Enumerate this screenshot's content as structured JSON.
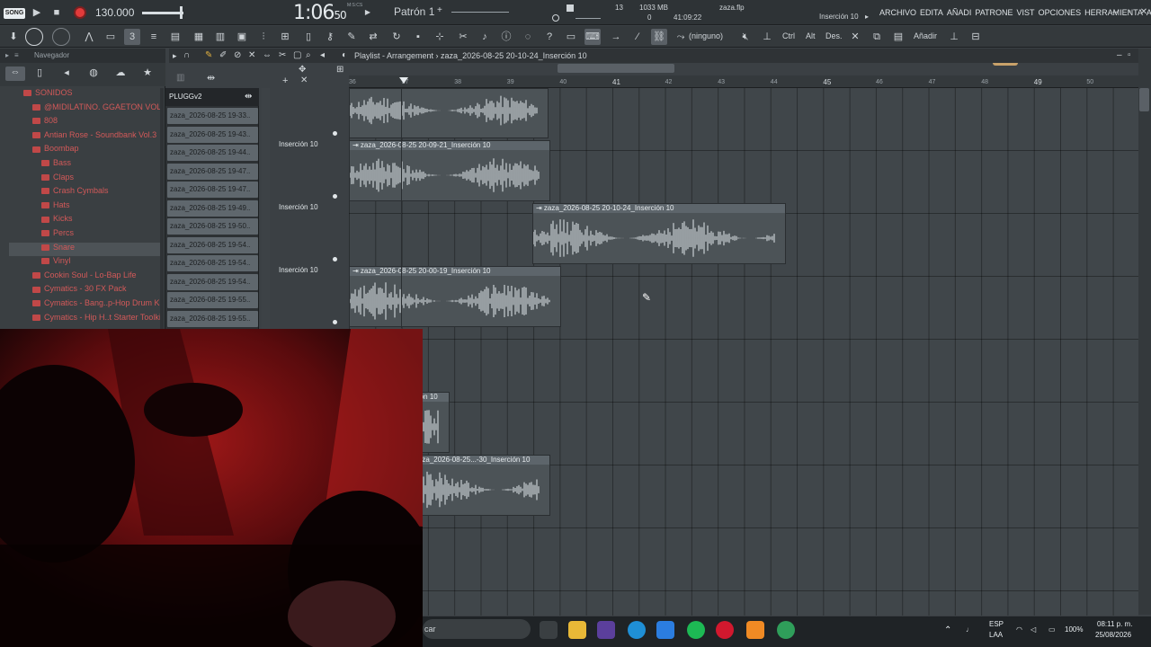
{
  "transport": {
    "mode_badge": "SONG",
    "play": "▶",
    "stop": "■",
    "tempo": "130.000",
    "time_main": "1:06",
    "time_small": "50",
    "time_label": "M:S:CS",
    "pattern": "Patrón 1",
    "cpu": "13",
    "mem": "1033 MB",
    "mem_sub": "0",
    "elapsed": "41:09:22",
    "file": "zaza.flp",
    "insert": "Inserción 10"
  },
  "menu": [
    "ARCHIVO",
    "EDITA",
    "AÑADI",
    "PATRONE",
    "VIST",
    "OPCIONES",
    "HERRAMIENTA",
    "AY"
  ],
  "toolbar": {
    "none_label": "(ninguno)",
    "ctrl": "Ctrl",
    "alt": "Alt",
    "des": "Des.",
    "add": "Añadir"
  },
  "browser": {
    "title": "Navegador",
    "items": [
      {
        "label": "SONIDOS",
        "level": 0,
        "selected": false
      },
      {
        "label": "@MIDILATINO. GGAETON VOL. 1",
        "level": 1,
        "selected": false
      },
      {
        "label": "808",
        "level": 1,
        "selected": false
      },
      {
        "label": "Antian Rose - Soundbank Vol.3",
        "level": 1,
        "selected": false
      },
      {
        "label": "Boombap",
        "level": 1,
        "selected": false
      },
      {
        "label": "Bass",
        "level": 2,
        "selected": false
      },
      {
        "label": "Claps",
        "level": 2,
        "selected": false
      },
      {
        "label": "Crash Cymbals",
        "level": 2,
        "selected": false
      },
      {
        "label": "Hats",
        "level": 2,
        "selected": false
      },
      {
        "label": "Kicks",
        "level": 2,
        "selected": false
      },
      {
        "label": "Percs",
        "level": 2,
        "selected": false
      },
      {
        "label": "Snare",
        "level": 2,
        "selected": true
      },
      {
        "label": "Vinyl",
        "level": 2,
        "selected": false
      },
      {
        "label": "Cookin Soul - Lo-Bap Life",
        "level": 1,
        "selected": false
      },
      {
        "label": "Cymatics - 30 FX Pack",
        "level": 1,
        "selected": false
      },
      {
        "label": "Cymatics - Bang..p-Hop Drum Kit",
        "level": 1,
        "selected": false
      },
      {
        "label": "Cymatics - Hip H..t Starter Toolkit",
        "level": 1,
        "selected": false
      }
    ]
  },
  "picker": {
    "header": "PLUGGv2",
    "items": [
      "zaza_2026-08-25 19-33..",
      "zaza_2026-08-25 19-43..",
      "zaza_2026-08-25 19-44..",
      "zaza_2026-08-25 19-47..",
      "zaza_2026-08-25 19-47..",
      "zaza_2026-08-25 19-49..",
      "zaza_2026-08-25 19-50..",
      "zaza_2026-08-25 19-54..",
      "zaza_2026-08-25 19-54..",
      "zaza_2026-08-25 19-54..",
      "zaza_2026-08-25 19-55..",
      "zaza_2026-08-25 19-55.."
    ]
  },
  "playlist": {
    "title": "Playlist - Arrangement",
    "breadcrumb": "zaza_2026-08-25 20-10-24_Inserción 10"
  },
  "ruler": [
    {
      "label": "36",
      "bar": false
    },
    {
      "label": "37",
      "bar": false
    },
    {
      "label": "38",
      "bar": false
    },
    {
      "label": "39",
      "bar": false
    },
    {
      "label": "40",
      "bar": false
    },
    {
      "label": "41",
      "bar": true
    },
    {
      "label": "42",
      "bar": false
    },
    {
      "label": "43",
      "bar": false
    },
    {
      "label": "44",
      "bar": false
    },
    {
      "label": "45",
      "bar": true
    },
    {
      "label": "46",
      "bar": false
    },
    {
      "label": "47",
      "bar": false
    },
    {
      "label": "48",
      "bar": false
    },
    {
      "label": "49",
      "bar": true
    },
    {
      "label": "50",
      "bar": false
    }
  ],
  "tracks": [
    "Inserción 10",
    "Inserción 10",
    "Inserción 10"
  ],
  "clips": [
    {
      "title": "",
      "track": 0
    },
    {
      "title": "zaza_2026-08-25 20-09-21_Inserción 10",
      "track": 1
    },
    {
      "title": "zaza_2026-08-25 20-10-24_Inserción 10",
      "track": 2
    },
    {
      "title": "zaza_2026-08-25 20-00-19_Inserción 10",
      "track": 3
    },
    {
      "title": "ción 10",
      "track": 5
    },
    {
      "title": "zaza_2026-08-25...-30_Inserción 10",
      "track": 6
    }
  ],
  "taskbar": {
    "search": "car",
    "lang": "ESP",
    "lang2": "LAA",
    "battery": "100%",
    "time": "08:11 p. m.",
    "date": "25/08/2026"
  },
  "colors": {
    "accent_red": "#d25959",
    "record": "#e23b3b",
    "clip_bg": "#4c5357",
    "waveform": "#c9cfd3"
  }
}
